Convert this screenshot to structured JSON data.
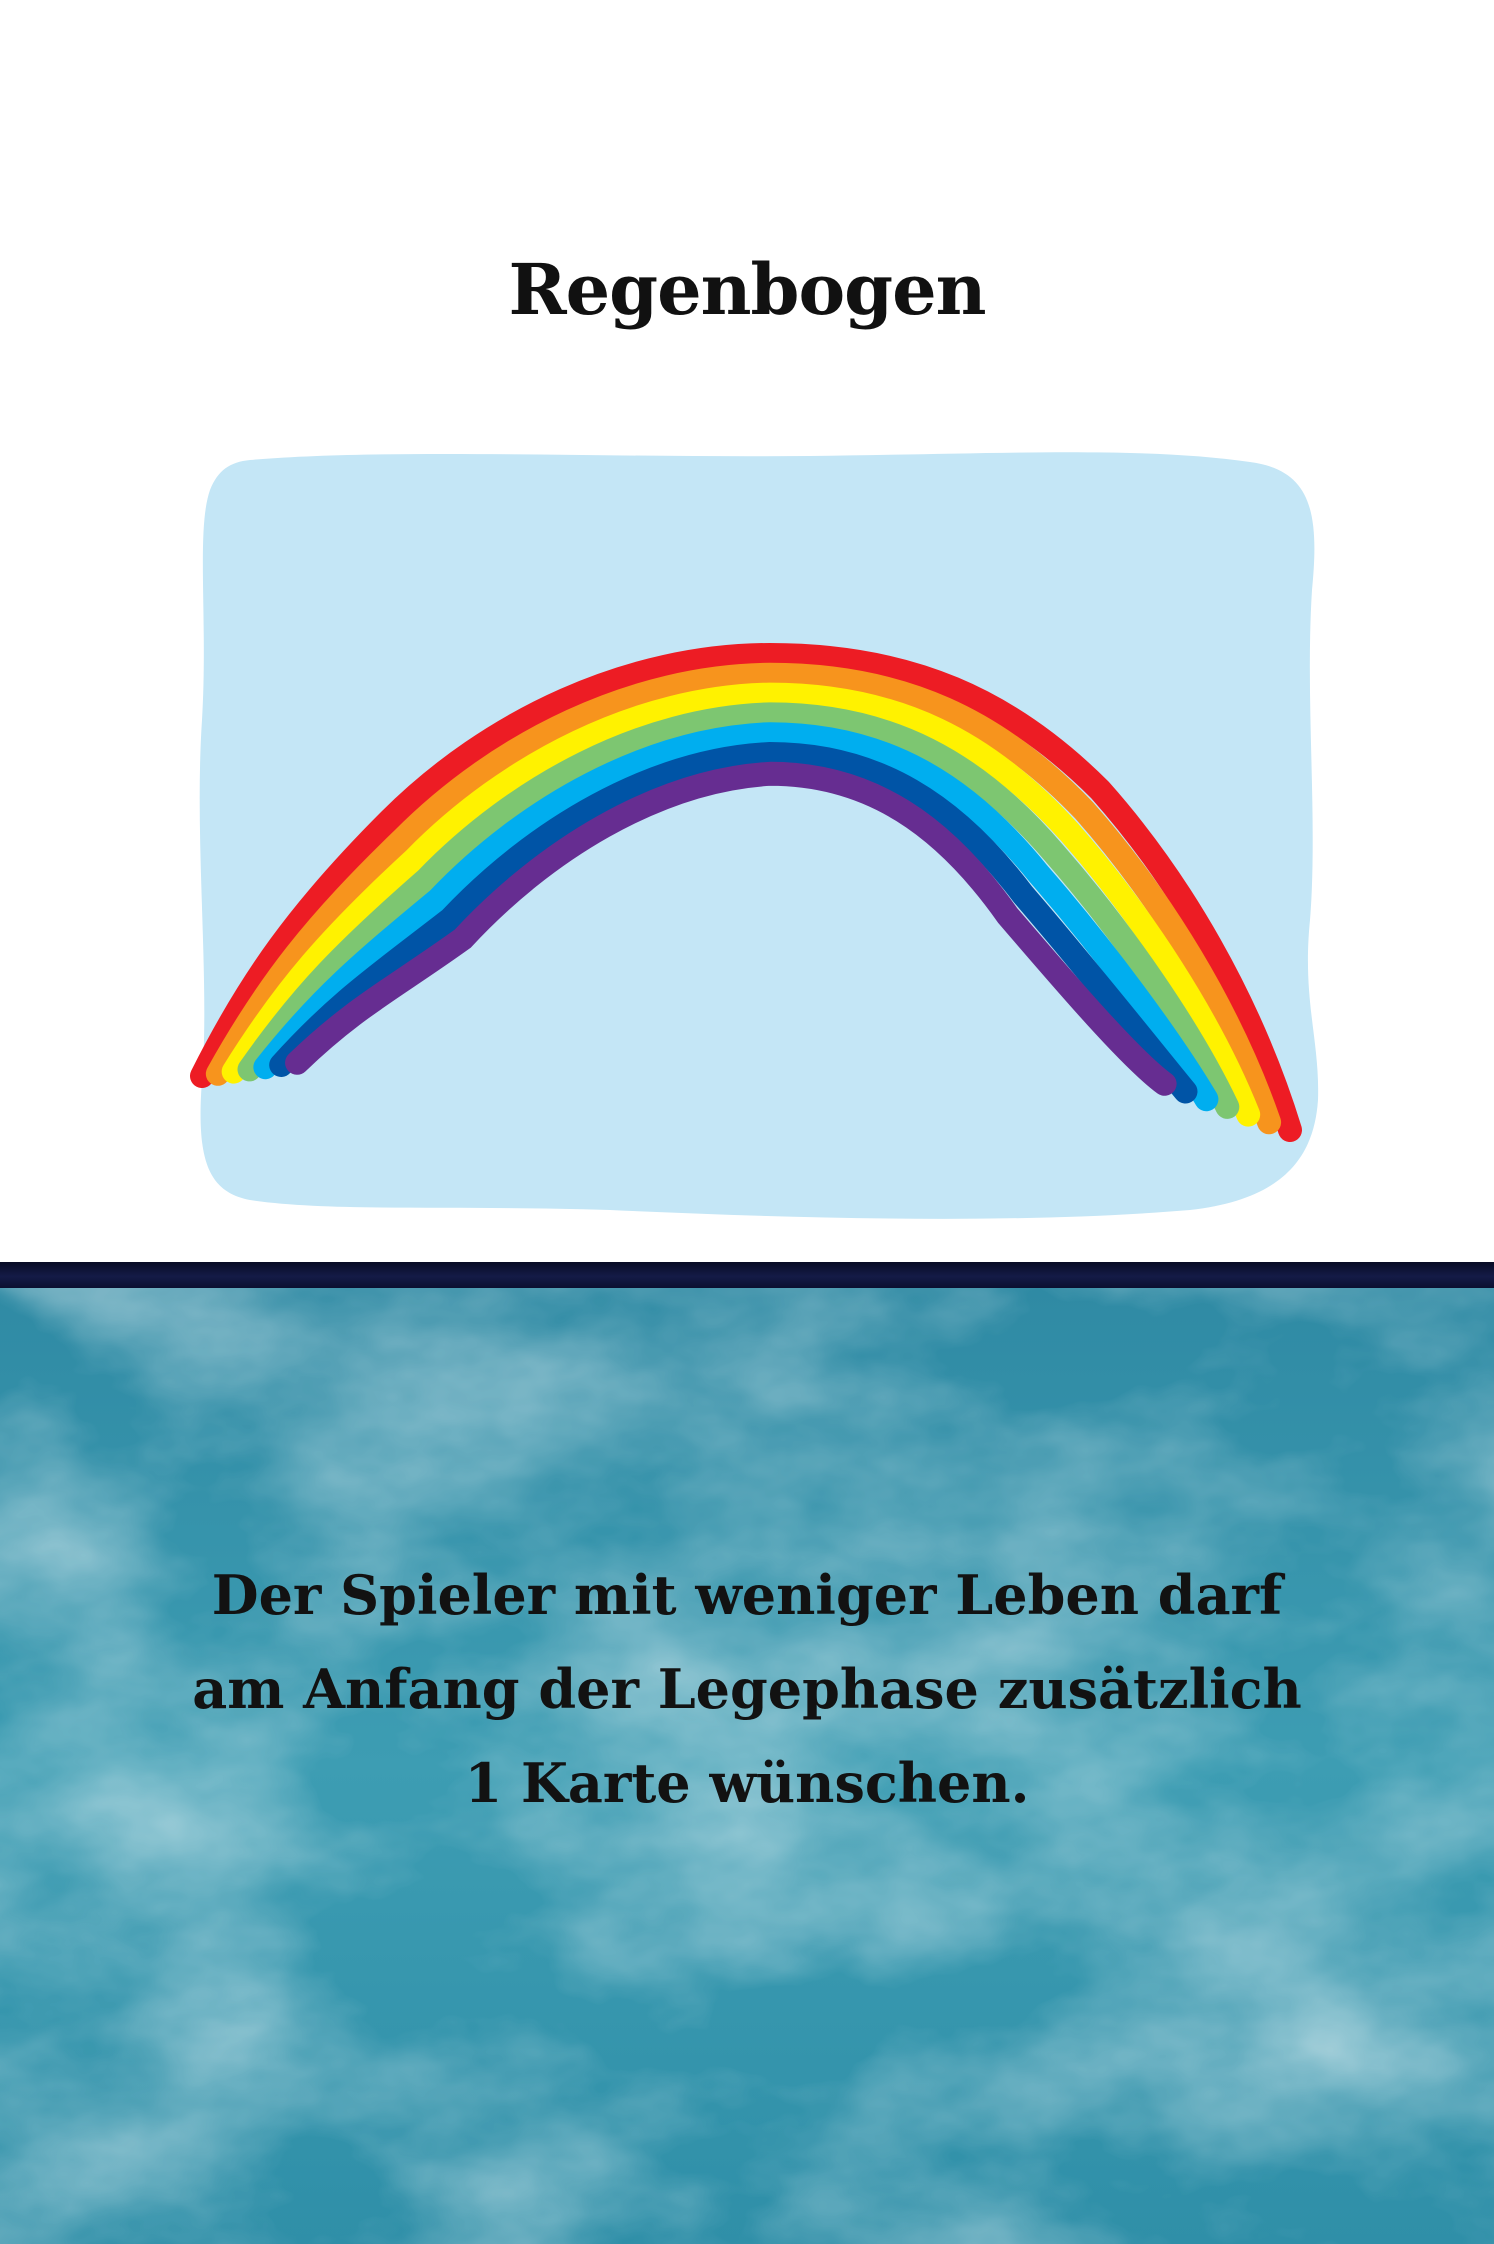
{
  "card": {
    "title": "Regenbogen",
    "rule_lines": [
      "Der Spieler mit weniger Leben darf",
      "am Anfang der Legephase zusätzlich",
      "1 Karte wünschen."
    ]
  },
  "illustration": {
    "subject": "rainbow-over-sky",
    "sky_color": "#c4e6f6",
    "band_colors": [
      "#ed1c24",
      "#f7941d",
      "#fff200",
      "#7dc671",
      "#00aeef",
      "#0054a6",
      "#662d91"
    ]
  },
  "colors": {
    "divider": "#0b1030",
    "panel": "#3a9ab0",
    "text": "#121212"
  }
}
